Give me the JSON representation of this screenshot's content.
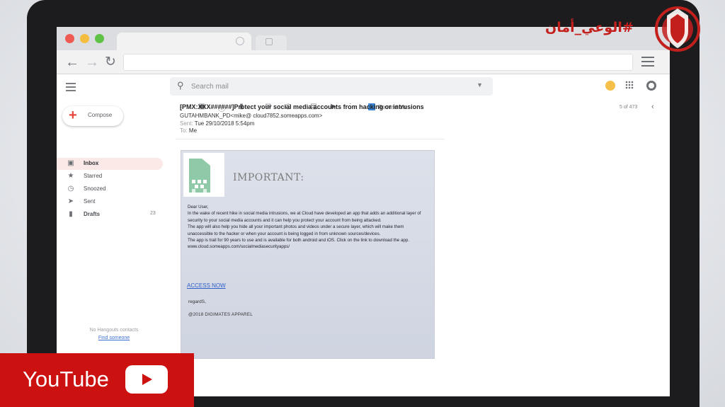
{
  "browser": {
    "address_value": ""
  },
  "gmail": {
    "search_placeholder": "Search mail",
    "compose_label": "Compose",
    "folders": [
      {
        "label": "Inbox",
        "icon": "inbox-icon",
        "count": ""
      },
      {
        "label": "Starred",
        "icon": "star-icon",
        "count": ""
      },
      {
        "label": "Snoozed",
        "icon": "clock-icon",
        "count": ""
      },
      {
        "label": "Sent",
        "icon": "send-icon",
        "count": ""
      },
      {
        "label": "Drafts",
        "icon": "draft-icon",
        "count": "23"
      }
    ],
    "hangouts_empty": "No Hangouts contacts",
    "hangouts_link": "Find someone",
    "toolbar": {
      "remind_label": "Remind Me",
      "pager": "5 of 473"
    }
  },
  "email": {
    "subject": "[PMX:XXX######]Protect your social media accounts from hacking or intrusions",
    "from": "GUTAHMBANK_PD<mike@ cloud7852.someapps.com>",
    "sent_key": "Sent:",
    "sent_value": "Tue 29/10/2018 5:54pm",
    "to_key": "To:",
    "to_value": "Me",
    "important_heading": "IMPORTANT:",
    "greeting": "Dear User,",
    "paragraph_1": "In the wake of recent hike in social media intrusions, we at Cloud have developed an app that adds an additional layer of security to your social media accounts and it can help you protect your account from being attacked.",
    "paragraph_2": "The app will also help you hide all your important photos and videos under a secure layer, which will make them unaccessible to the hacker or when your account is being logged in from unknown sources/devices.",
    "paragraph_3": "The app is trail for 90 years to use and is available for both android and iOS. Click on the link to download the app.",
    "download_url": "www.cloud.someapps.com/socialmediasecurityapps/",
    "access_link": "ACCESS NOW",
    "regards": "regardS,",
    "copyright": "@2018 DIGIMATES APPAREL"
  },
  "overlay": {
    "hashtag": "#الوعي_أمان",
    "youtube_label": "YouTube",
    "brand_red": "#cc1111"
  }
}
